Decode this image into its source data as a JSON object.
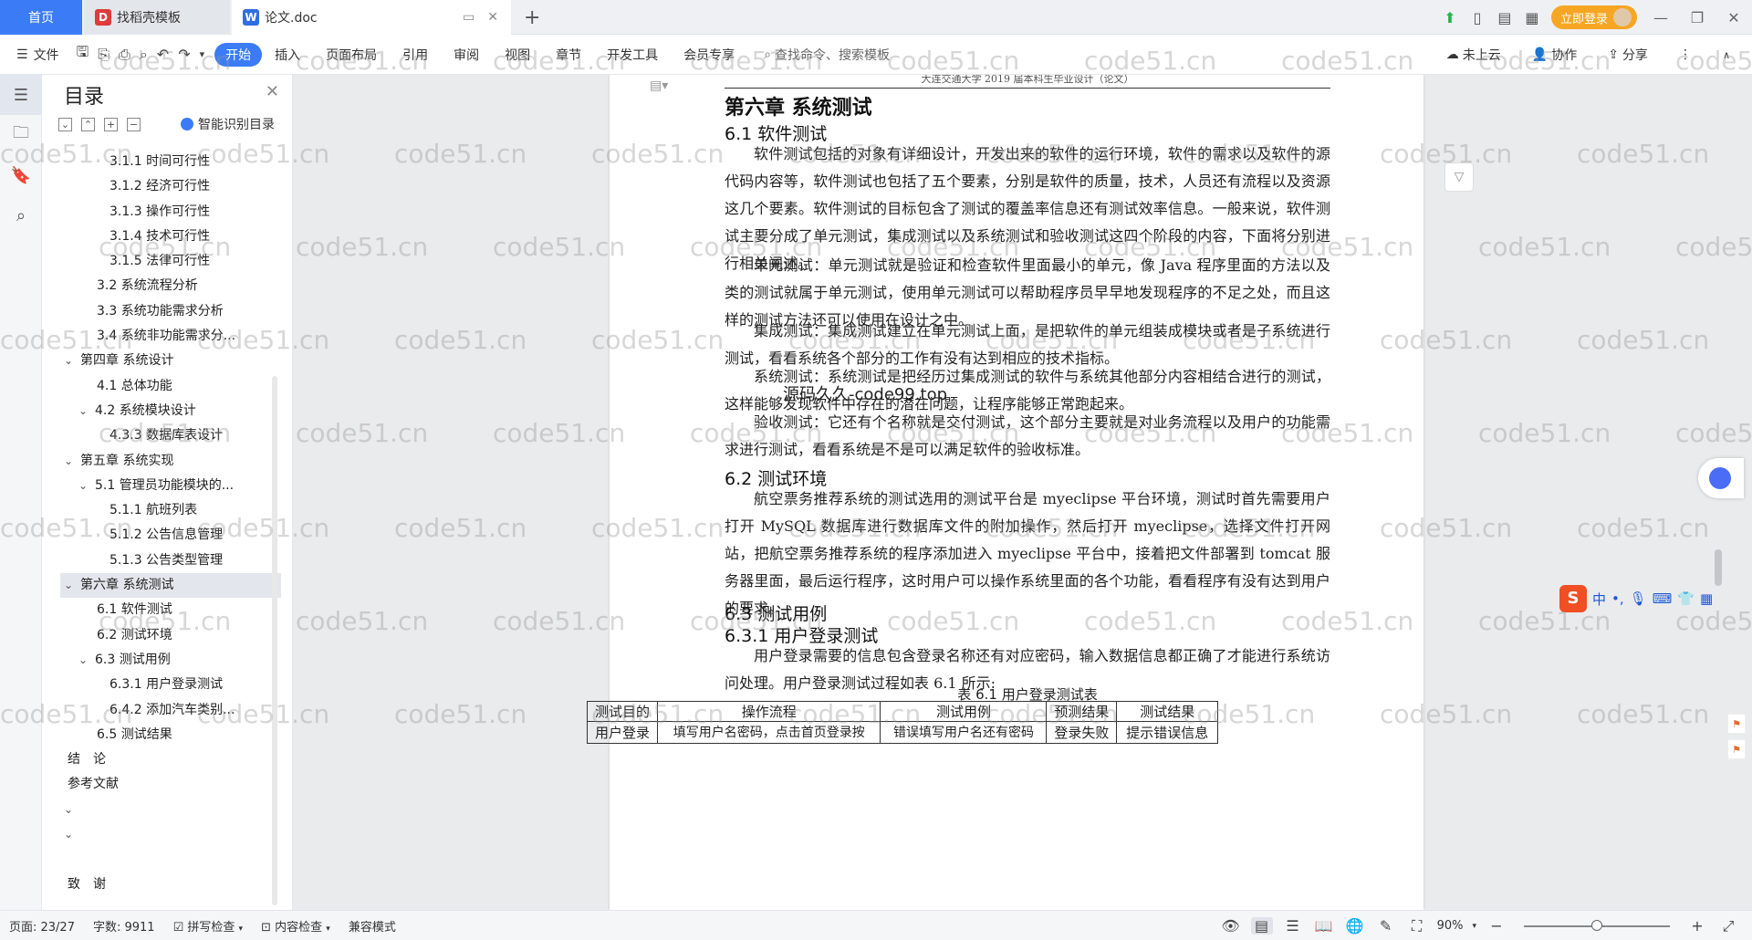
{
  "titlebar": {
    "home_tab": "首页",
    "template_tab": "找稻壳模板",
    "doc_tab": "论文.doc",
    "login_button": "立即登录"
  },
  "ribbon": {
    "menu_label": "文件",
    "tabs": [
      "开始",
      "插入",
      "页面布局",
      "引用",
      "审阅",
      "视图",
      "章节",
      "开发工具",
      "会员专享"
    ],
    "search_placeholder": "查找命令、搜索模板",
    "cloud_label": "未上云",
    "collab_label": "协作",
    "share_label": "分享"
  },
  "toc": {
    "title": "目录",
    "smart_label": "智能识别目录",
    "items": [
      {
        "text": "3.1.1 时间可行性",
        "level": 3
      },
      {
        "text": "3.1.2 经济可行性",
        "level": 3
      },
      {
        "text": "3.1.3 操作可行性",
        "level": 3
      },
      {
        "text": "3.1.4 技术可行性",
        "level": 3
      },
      {
        "text": "3.1.5 法律可行性",
        "level": 3
      },
      {
        "text": "3.2 系统流程分析",
        "level": 2
      },
      {
        "text": "3.3 系统功能需求分析",
        "level": 2
      },
      {
        "text": "3.4 系统非功能需求分...",
        "level": 2
      },
      {
        "text": "第四章 系统设计",
        "level": 1,
        "expanded": true
      },
      {
        "text": "4.1 总体功能",
        "level": 2
      },
      {
        "text": "4.2 系统模块设计",
        "level": 2,
        "expanded": true
      },
      {
        "text": "4.3.3 数据库表设计",
        "level": 3
      },
      {
        "text": "第五章 系统实现",
        "level": 1,
        "expanded": true
      },
      {
        "text": "5.1 管理员功能模块的...",
        "level": 2,
        "expanded": true
      },
      {
        "text": "5.1.1 航班列表",
        "level": 3
      },
      {
        "text": "5.1.2 公告信息管理",
        "level": 3
      },
      {
        "text": "5.1.3 公告类型管理",
        "level": 3
      },
      {
        "text": "第六章 系统测试",
        "level": 1,
        "expanded": true,
        "selected": true
      },
      {
        "text": "6.1 软件测试",
        "level": 2
      },
      {
        "text": "6.2 测试环境",
        "level": 2
      },
      {
        "text": "6.3 测试用例",
        "level": 2,
        "expanded": true
      },
      {
        "text": "6.3.1 用户登录测试",
        "level": 3
      },
      {
        "text": "6.4.2 添加汽车类别...",
        "level": 3
      },
      {
        "text": "6.5 测试结果",
        "level": 2
      },
      {
        "text": "结　论",
        "level": 0
      },
      {
        "text": "参考文献",
        "level": 0
      },
      {
        "text": "",
        "level": 0,
        "expanded": true
      },
      {
        "text": "",
        "level": 0,
        "expanded": true
      },
      {
        "text": "",
        "level": 0
      },
      {
        "text": "致　谢",
        "level": 0
      }
    ]
  },
  "document": {
    "header": "大连交通大学 2019 届本科生毕业设计（论文）",
    "chapter_title": "第六章  系统测试",
    "s61": "6.1 软件测试",
    "p1": "软件测试包括的对象有详细设计，开发出来的软件的运行环境，软件的需求以及软件的源代码内容等，软件测试也包括了五个要素，分别是软件的质量，技术，人员还有流程以及资源这几个要素。软件测试的目标包含了测试的覆盖率信息还有测试效率信息。一般来说，软件测试主要分成了单元测试，集成测试以及系统测试和验收测试这四个阶段的内容，下面将分别进行相关阐述。",
    "p2": "单元测试：单元测试就是验证和检查软件里面最小的单元，像 Java 程序里面的方法以及类的测试就属于单元测试，使用单元测试可以帮助程序员早早地发现程序的不足之处，而且这样的测试方法还可以使用在设计之中。",
    "p3": "集成测试：集成测试建立在单元测试上面，是把软件的单元组装成模块或者是子系统进行测试，看看系统各个部分的工作有没有达到相应的技术指标。",
    "p4": "系统测试：系统测试是把经历过集成测试的软件与系统其他部分内容相结合进行的测试，这样能够发现软件中存在的潜在问题，让程序能够正常跑起来。",
    "p5": "验收测试：它还有个名称就是交付测试，这个部分主要就是对业务流程以及用户的功能需求进行测试，看看系统是不是可以满足软件的验收标准。",
    "overlay_text": "源码久久-code99.top",
    "s62": "6.2 测试环境",
    "p6": "航空票务推荐系统的测试选用的测试平台是 myeclipse 平台环境，测试时首先需要用户打开 MySQL 数据库进行数据库文件的附加操作，然后打开 myeclipse，选择文件打开网站，把航空票务推荐系统的程序添加进入 myeclipse 平台中，接着把文件部署到 tomcat 服务器里面，最后运行程序，这时用户可以操作系统里面的各个功能，看看程序有没有达到用户的要求。",
    "s63": "6.3  测试用例",
    "s631": "6.3.1  用户登录测试",
    "p7": "用户登录需要的信息包含登录名称还有对应密码，输入数据信息都正确了才能进行系统访问处理。用户登录测试过程如表 6.1 所示:",
    "table_caption": "表 6.1    用户登录测试表",
    "table_headers": [
      "测试目的",
      "操作流程",
      "测试用例",
      "预测结果",
      "测试结果"
    ],
    "table_row": [
      "用户登录",
      "填写用户名密码，点击首页登录按",
      "错误填写用户名还有密码",
      "登录失败",
      "提示错误信息"
    ]
  },
  "ime": {
    "lang": "中"
  },
  "watermark": "code51.cn",
  "status": {
    "page": "页面: 23/27",
    "words": "字数: 9911",
    "spell": "拼写检查",
    "content_check": "内容检查",
    "compat": "兼容模式",
    "zoom": "90%"
  },
  "colors": {
    "accent": "#3b7cf6",
    "login": "#f7a623",
    "ime": "#f04e23"
  }
}
